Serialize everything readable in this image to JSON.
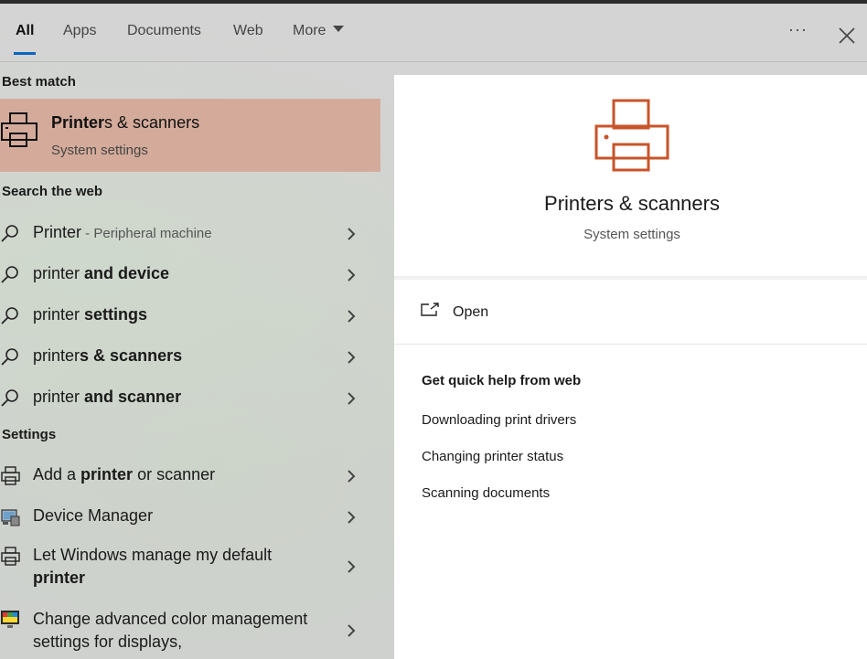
{
  "colors": {
    "accent": "#0a64c0",
    "highlight": "#d4ab9a",
    "printer_icon": "#c8542a"
  },
  "tabs": [
    {
      "label": "All",
      "active": true
    },
    {
      "label": "Apps"
    },
    {
      "label": "Documents"
    },
    {
      "label": "Web"
    },
    {
      "label": "More"
    }
  ],
  "header": {
    "more_icon": "ellipsis-icon",
    "close_icon": "close-icon"
  },
  "left": {
    "best_match_heading": "Best match",
    "best_match": {
      "title_bold": "Printer",
      "title_rest": "s & scanners",
      "subtitle": "System settings",
      "icon": "printer-icon"
    },
    "search_web_heading": "Search the web",
    "web_results": [
      {
        "plain": "Printer",
        "muted": " - Peripheral machine",
        "bold": ""
      },
      {
        "plain": "printer ",
        "bold": "and device"
      },
      {
        "plain": "printer ",
        "bold": "settings"
      },
      {
        "plain": "printer",
        "bold": "s & scanners"
      },
      {
        "plain": "printer ",
        "bold": "and scanner"
      }
    ],
    "settings_heading": "Settings",
    "settings_results": [
      {
        "pre": "Add a ",
        "bold": "printer",
        "post": " or scanner",
        "icon": "printer-icon"
      },
      {
        "pre": "Device Manager",
        "bold": "",
        "post": "",
        "icon": "device-manager-icon"
      },
      {
        "pre": "Let Windows manage my default ",
        "bold": "printer",
        "post": "",
        "icon": "printer-icon"
      },
      {
        "pre": "Change advanced color management settings for displays,",
        "bold": "",
        "post": "",
        "icon": "color-management-icon"
      }
    ]
  },
  "right": {
    "title": "Printers & scanners",
    "subtitle": "System settings",
    "open_label": "Open",
    "quick_help_heading": "Get quick help from web",
    "links": [
      "Downloading print drivers",
      "Changing printer status",
      "Scanning documents"
    ]
  }
}
